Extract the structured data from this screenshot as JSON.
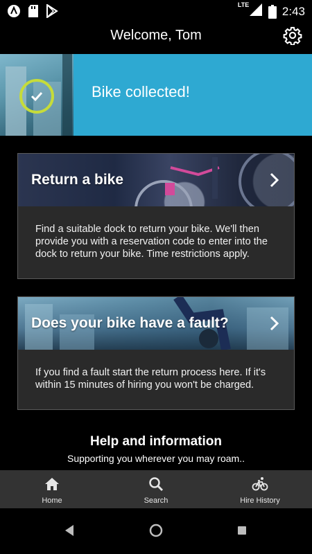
{
  "status_bar": {
    "time": "2:43",
    "network": "LTE",
    "icons": [
      "assistant-icon",
      "sd-card-icon",
      "play-store-icon",
      "signal-icon",
      "battery-icon"
    ]
  },
  "header": {
    "title": "Welcome, Tom",
    "settings_icon": "gear-icon"
  },
  "banner": {
    "message": "Bike collected!",
    "icon": "check-circle-icon",
    "accent": "#2ea9d2",
    "check_color": "#c6dc3a"
  },
  "cards": [
    {
      "title": "Return a bike",
      "body": "Find a suitable dock to return your bike. We'll then provide you with a reservation code to enter into the dock to return your bike. Time restrictions apply.",
      "icon": "chevron-right-icon"
    },
    {
      "title": "Does your bike have a fault?",
      "body": "If you find a fault start the return process here. If it's within 15 minutes of hiring you won't be charged.",
      "icon": "chevron-right-icon"
    }
  ],
  "help": {
    "title": "Help and information",
    "subtitle": "Supporting you wherever you may roam.."
  },
  "bottom_nav": {
    "items": [
      {
        "label": "Home",
        "icon": "home-icon"
      },
      {
        "label": "Search",
        "icon": "search-icon"
      },
      {
        "label": "Hire History",
        "icon": "bike-icon"
      }
    ]
  },
  "system_nav": {
    "icons": [
      "back-icon",
      "home-circle-icon",
      "recents-icon"
    ]
  }
}
